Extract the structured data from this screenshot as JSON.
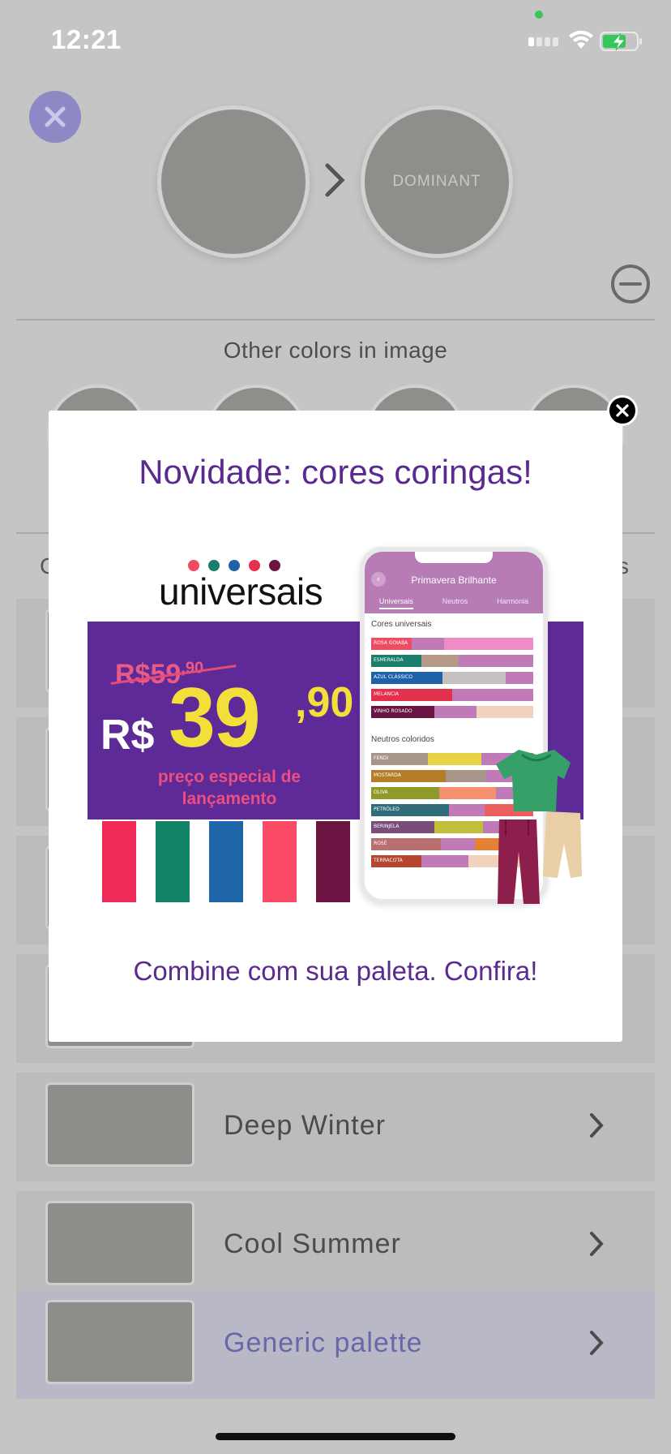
{
  "status_bar": {
    "time": "12:21"
  },
  "color_analysis": {
    "dominant_label": "DOMINANT",
    "other_colors_title": "Other colors in image",
    "peek_left": "C",
    "peek_right": "s"
  },
  "palettes": [
    {
      "label": "Deep Winter"
    },
    {
      "label": "Cool Summer"
    },
    {
      "label": "Generic palette"
    }
  ],
  "modal": {
    "title": "Novidade: cores coringas!",
    "cta": "Combine com sua paleta. Confira!",
    "promo": {
      "brand": "universais",
      "old_price_whole": "R$59",
      "old_price_cents": ",90",
      "currency": "R$",
      "price_whole": "39",
      "price_cents": ",90",
      "tagline": "preço especial de lançamento",
      "dot_colors": [
        "#ef4b63",
        "#1a7e6a",
        "#1f62a8",
        "#e3304d",
        "#6a1444"
      ],
      "stripe_colors": [
        "#ef2a57",
        "#148469",
        "#1f66a8",
        "#fb4b67",
        "#6b1341"
      ],
      "phone": {
        "title": "Primavera Brilhante",
        "tabs": [
          "Universais",
          "Neutros",
          "Harmonia"
        ],
        "section_1": "Cores universais",
        "section_2": "Neutros coloridos",
        "universal_rows": [
          "ROSA GOIABA",
          "ESMERALDA",
          "AZUL CLÁSSICO",
          "MELANCIA",
          "VINHO ROSADO"
        ],
        "neutral_rows": [
          "FENDI",
          "MOSTARDA",
          "OLIVA",
          "PETRÓLEO",
          "BERINJELA",
          "ROSÉ",
          "TERRACOTA"
        ]
      }
    }
  }
}
